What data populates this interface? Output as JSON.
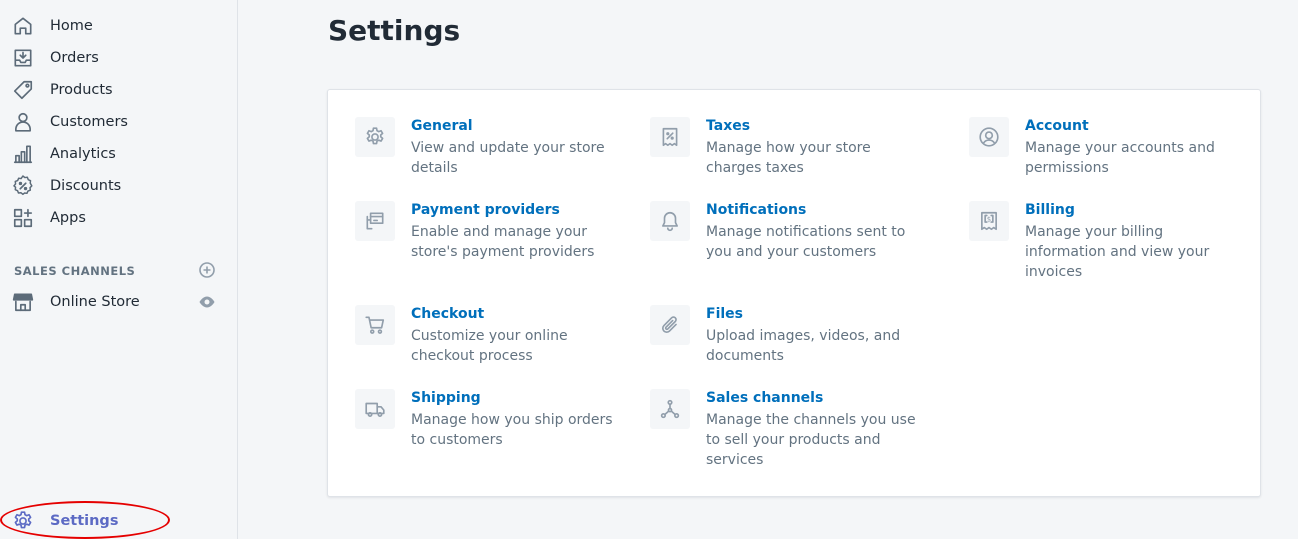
{
  "sidebar": {
    "items": [
      {
        "label": "Home",
        "icon": "home-icon"
      },
      {
        "label": "Orders",
        "icon": "inbox-download-icon"
      },
      {
        "label": "Products",
        "icon": "tag-icon"
      },
      {
        "label": "Customers",
        "icon": "person-icon"
      },
      {
        "label": "Analytics",
        "icon": "bar-chart-icon"
      },
      {
        "label": "Discounts",
        "icon": "discount-badge-icon"
      },
      {
        "label": "Apps",
        "icon": "apps-grid-icon"
      }
    ],
    "sales_channels_title": "SALES CHANNELS",
    "online_store_label": "Online Store",
    "settings_label": "Settings"
  },
  "page": {
    "title": "Settings"
  },
  "settings": [
    {
      "title": "General",
      "description": "View and update your store details",
      "icon": "gear-icon"
    },
    {
      "title": "Taxes",
      "description": "Manage how your store charges taxes",
      "icon": "receipt-percent-icon"
    },
    {
      "title": "Account",
      "description": "Manage your accounts and permissions",
      "icon": "profile-circle-icon"
    },
    {
      "title": "Payment providers",
      "description": "Enable and manage your store's payment providers",
      "icon": "credit-card-icon"
    },
    {
      "title": "Notifications",
      "description": "Manage notifications sent to you and your customers",
      "icon": "bell-icon"
    },
    {
      "title": "Billing",
      "description": "Manage your billing information and view your invoices",
      "icon": "invoice-dollar-icon"
    },
    {
      "title": "Checkout",
      "description": "Customize your online checkout process",
      "icon": "cart-icon"
    },
    {
      "title": "Files",
      "description": "Upload images, videos, and documents",
      "icon": "paperclip-icon"
    },
    {
      "title": "Shipping",
      "description": "Manage how you ship orders to customers",
      "icon": "truck-icon"
    },
    {
      "title": "Sales channels",
      "description": "Manage the channels you use to sell your products and services",
      "icon": "channels-icon"
    }
  ],
  "colors": {
    "link": "#006fbb",
    "accent": "#5c6ac4",
    "highlight_ring": "#e50000"
  }
}
